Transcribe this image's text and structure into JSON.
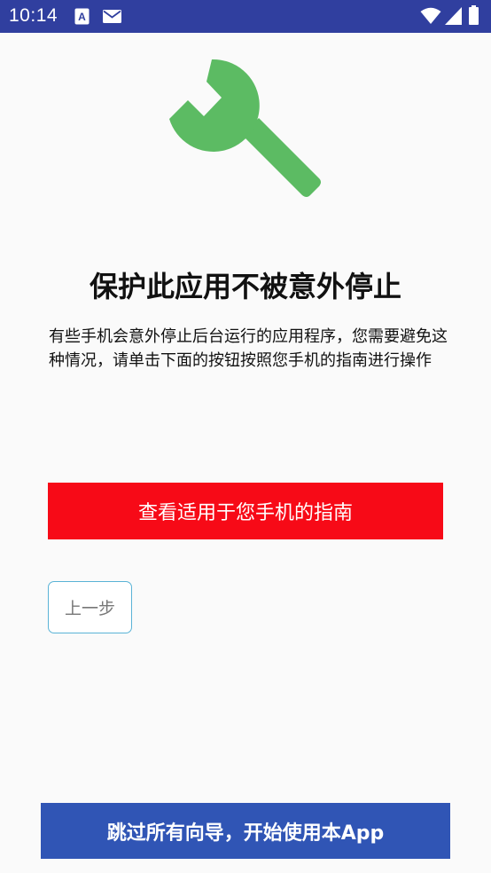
{
  "status_bar": {
    "time": "10:14",
    "left_icons": [
      "text-a-notification-icon",
      "mail-icon"
    ],
    "right_icons": [
      "wifi-icon",
      "signal-icon",
      "battery-icon"
    ],
    "color": "#303f9f"
  },
  "hero": {
    "icon": "wrench-icon",
    "icon_color": "#5cbb63"
  },
  "title": "保护此应用不被意外停止",
  "description": "有些手机会意外停止后台运行的应用程序，您需要避免这种情况，请单击下面的按钮按照您手机的指南进行操作",
  "buttons": {
    "guide_label": "查看适用于您手机的指南",
    "guide_color": "#f70a17",
    "back_label": "上一步",
    "skip_label": "跳过所有向导，开始使用本App",
    "skip_color": "#3055b5"
  }
}
